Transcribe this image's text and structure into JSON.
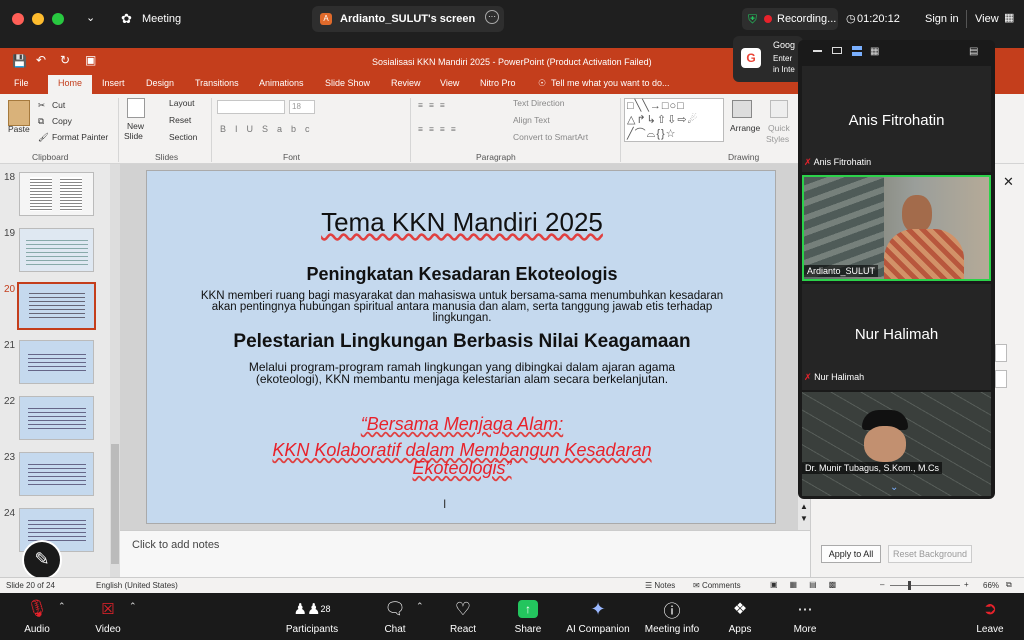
{
  "zoom": {
    "meeting_label": "Meeting",
    "share_tab": "Ardianto_SULUT's screen",
    "recording": "Recording...",
    "timer": "01:20:12",
    "signin": "Sign in",
    "view": "View",
    "toast": {
      "title": "Goog",
      "line1": "Enter",
      "line2": "in Inte"
    }
  },
  "ppt": {
    "title": "Sosialisasi KKN Mandiri 2025 - PowerPoint (Product Activation Failed)",
    "tabs": [
      "File",
      "Home",
      "Insert",
      "Design",
      "Transitions",
      "Animations",
      "Slide Show",
      "Review",
      "View",
      "Nitro Pro"
    ],
    "tellme": "Tell me what you want to do...",
    "ribbon": {
      "paste": "Paste",
      "cut": "Cut",
      "copy": "Copy",
      "format_painter": "Format Painter",
      "clipboard": "Clipboard",
      "new_slide": "New",
      "new_slide2": "Slide",
      "layout": "Layout",
      "reset": "Reset",
      "section": "Section",
      "slides": "Slides",
      "font_size": "18",
      "font": "Font",
      "text_direction": "Text Direction",
      "align_text": "Align Text",
      "convert": "Convert to SmartArt",
      "paragraph": "Paragraph",
      "arrange": "Arrange",
      "quick": "Quick",
      "styles": "Styles",
      "drawing": "Drawing"
    },
    "thumb_numbers": [
      "18",
      "19",
      "20",
      "21",
      "22",
      "23",
      "24"
    ],
    "slide": {
      "title": "Tema KKN Mandiri 2025",
      "h1": "Peningkatan Kesadaran Ekoteologis",
      "p1": "KKN memberi ruang bagi masyarakat dan mahasiswa untuk bersama-sama menumbuhkan kesadaran akan pentingnya hubungan spiritual antara manusia dan alam, serta tanggung jawab etis terhadap lingkungan.",
      "h2": "Pelestarian Lingkungan Berbasis Nilai Keagamaan",
      "p2": "Melalui program-program ramah lingkungan yang dibingkai dalam ajaran agama (ekoteologi), KKN membantu menjaga kelestarian alam secara berkelanjutan.",
      "quote1": "“Bersama Menjaga Alam:",
      "quote2": "KKN Kolaboratif dalam Membangun Kesadaran",
      "quote3": "Ekoteologis”"
    },
    "notes_placeholder": "Click to add notes",
    "apply_all": "Apply to All",
    "reset_bg": "Reset Background",
    "status": {
      "slide": "Slide 20 of 24",
      "lang": "English (United States)",
      "notes": "Notes",
      "comments": "Comments",
      "zoom": "66%"
    }
  },
  "participants": [
    {
      "name": "Anis Fitrohatin",
      "label": "Anis Fitrohatin"
    },
    {
      "name": "Ardianto_SULUT"
    },
    {
      "name": "Nur Halimah",
      "label": "Nur Halimah"
    },
    {
      "name": "Dr. Munir Tubagus, S.Kom., M.Cs"
    }
  ],
  "toolbar": {
    "audio": "Audio",
    "video": "Video",
    "participants": "Participants",
    "participants_count": "28",
    "chat": "Chat",
    "react": "React",
    "share": "Share",
    "ai": "AI Companion",
    "info": "Meeting info",
    "apps": "Apps",
    "more": "More",
    "leave": "Leave"
  },
  "colors": {
    "ppt_red": "#c43e1c",
    "zoom_bg": "#1a1a1a",
    "active_speaker": "#2bd24a",
    "share_green": "#23c55e",
    "quote_red": "#e8222b"
  }
}
